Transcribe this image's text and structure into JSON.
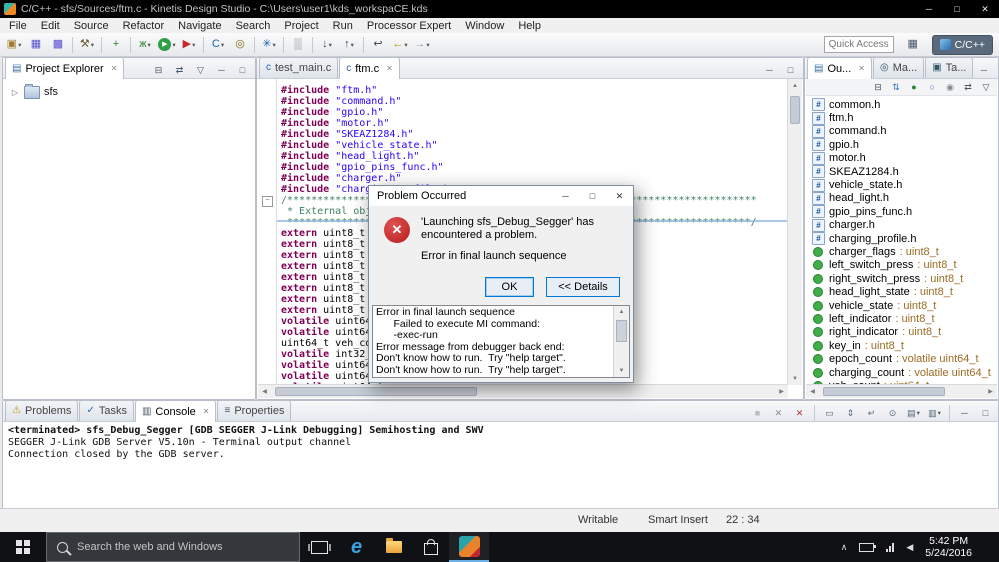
{
  "titlebar": {
    "title": "C/C++ - sfs/Sources/ftm.c - Kinetis Design Studio - C:\\Users\\user1\\kds_workspaCE.kds",
    "minimize": "─",
    "maximize": "□",
    "close": "✕"
  },
  "menubar": [
    "File",
    "Edit",
    "Source",
    "Refactor",
    "Navigate",
    "Search",
    "Project",
    "Run",
    "Processor Expert",
    "Window",
    "Help"
  ],
  "toolbar": {
    "quick_access": "Quick Access",
    "perspective": "C/C++",
    "items": [
      {
        "name": "new-wizard-icon",
        "glyph": "▣",
        "color": "#a07c2c",
        "dd": true
      },
      {
        "name": "save-icon",
        "glyph": "▦",
        "color": "#5a4fcf"
      },
      {
        "name": "save-all-icon",
        "glyph": "▩",
        "color": "#5a4fcf"
      },
      {
        "sep": true
      },
      {
        "name": "build-icon",
        "glyph": "⚒",
        "color": "#6b5b35",
        "dd": true
      },
      {
        "sep": true
      },
      {
        "name": "new-connection-icon",
        "glyph": "+",
        "color": "#2e7d32"
      },
      {
        "sep": true
      },
      {
        "name": "debug-icon",
        "glyph": "ж",
        "color": "#2e7d32",
        "dd": true
      },
      {
        "name": "run-icon",
        "glyph": "▶",
        "color": "#ffffff",
        "bg": "#2f9e44",
        "dd": true
      },
      {
        "name": "external-tools-icon",
        "glyph": "▶",
        "color": "#c62828",
        "dd": true
      },
      {
        "sep": true
      },
      {
        "name": "new-c-file-icon",
        "glyph": "C",
        "color": "#1c5fae",
        "dd": true
      },
      {
        "name": "open-element-icon",
        "glyph": "◎",
        "color": "#7a6a1f"
      },
      {
        "sep": true
      },
      {
        "name": "search-icon",
        "glyph": "✳",
        "color": "#1c5fae",
        "dd": true
      },
      {
        "sep": true
      },
      {
        "name": "mark-occurrences-icon",
        "glyph": "▒",
        "color": "#888888"
      },
      {
        "sep": true
      },
      {
        "name": "next-annotation-icon",
        "glyph": "↓",
        "color": "#444444",
        "dd": true
      },
      {
        "name": "previous-annotation-icon",
        "glyph": "↑",
        "color": "#444444",
        "dd": true
      },
      {
        "sep": true
      },
      {
        "name": "last-edit-location-icon",
        "glyph": "↩",
        "color": "#444444"
      },
      {
        "name": "back-icon",
        "glyph": "←",
        "color": "#b58900",
        "dd": true
      },
      {
        "name": "forward-icon",
        "glyph": "→",
        "color": "#999999",
        "dd": true
      }
    ]
  },
  "project_explorer": {
    "tabs": [
      {
        "id": "tab-project-explorer",
        "label": "Project Explorer",
        "glyph": "▤",
        "color": "#3b6ea5",
        "active": true,
        "closable": true
      }
    ],
    "header_icons": [
      {
        "name": "collapse-all-icon",
        "glyph": "⊟",
        "color": "#445566"
      },
      {
        "name": "link-with-editor-icon",
        "glyph": "⇄",
        "color": "#445566"
      },
      {
        "name": "view-menu-icon",
        "glyph": "▽",
        "color": "#445566"
      },
      {
        "name": "minimize-view-icon",
        "glyph": "─",
        "color": "#445566"
      },
      {
        "name": "maximize-view-icon",
        "glyph": "□",
        "color": "#445566"
      }
    ],
    "items": [
      {
        "label": "sfs",
        "expander": "▷"
      }
    ]
  },
  "editor": {
    "tabs": [
      {
        "id": "tab-test-main-c",
        "label": "test_main.c",
        "glyph": "c",
        "color": "#1c5fae",
        "active": false
      },
      {
        "id": "tab-ftm-c",
        "label": "ftm.c",
        "glyph": "c",
        "color": "#1c5fae",
        "active": true,
        "closable": true
      }
    ],
    "chrome_icons": [
      {
        "name": "minimize-view-icon",
        "glyph": "─",
        "color": "#445566"
      },
      {
        "name": "maximize-view-icon",
        "glyph": "□",
        "color": "#445566"
      }
    ],
    "scroll": {
      "up": "▲",
      "down": "▼",
      "left": "◀",
      "right": "▶"
    },
    "lines": [
      {
        "segs": [
          {
            "t": "#include ",
            "c": "pp"
          },
          {
            "t": "\"ftm.h\"",
            "c": "str"
          }
        ]
      },
      {
        "segs": [
          {
            "t": "#include ",
            "c": "pp"
          },
          {
            "t": "\"command.h\"",
            "c": "str"
          }
        ]
      },
      {
        "segs": [
          {
            "t": "#include ",
            "c": "pp"
          },
          {
            "t": "\"gpio.h\"",
            "c": "str"
          }
        ]
      },
      {
        "segs": [
          {
            "t": "#include ",
            "c": "pp"
          },
          {
            "t": "\"motor.h\"",
            "c": "str"
          }
        ]
      },
      {
        "segs": [
          {
            "t": "#include ",
            "c": "pp"
          },
          {
            "t": "\"SKEAZ1284.h\"",
            "c": "str"
          }
        ]
      },
      {
        "segs": [
          {
            "t": "#include ",
            "c": "pp"
          },
          {
            "t": "\"vehicle_state.h\"",
            "c": "str"
          }
        ]
      },
      {
        "segs": [
          {
            "t": "#include ",
            "c": "pp"
          },
          {
            "t": "\"head_light.h\"",
            "c": "str"
          }
        ]
      },
      {
        "segs": [
          {
            "t": "#include ",
            "c": "pp"
          },
          {
            "t": "\"gpio_pins_func.h\"",
            "c": "str"
          }
        ]
      },
      {
        "segs": [
          {
            "t": "#include ",
            "c": "pp"
          },
          {
            "t": "\"charger.h\"",
            "c": "str"
          }
        ]
      },
      {
        "segs": [
          {
            "t": "#include ",
            "c": "pp"
          },
          {
            "t": "\"charging_profile.h\"",
            "c": "str"
          }
        ]
      },
      {
        "segs": [
          {
            "t": "/******************************************************************************",
            "c": "cmt"
          }
        ]
      },
      {
        "segs": [
          {
            "t": " * External objec",
            "c": "cmt"
          }
        ]
      },
      {
        "segs": [
          {
            "t": " *****************************************************************************/",
            "c": "cmt"
          }
        ]
      },
      {
        "segs": [
          {
            "t": "extern",
            "c": "kw"
          },
          {
            "t": " uint8_t ch",
            "c": "pl"
          }
        ]
      },
      {
        "segs": [
          {
            "t": "extern",
            "c": "kw"
          },
          {
            "t": " uint8_t le",
            "c": "pl"
          }
        ]
      },
      {
        "segs": [
          {
            "t": "extern",
            "c": "kw"
          },
          {
            "t": " uint8_t ri",
            "c": "pl"
          }
        ]
      },
      {
        "segs": [
          {
            "t": "extern",
            "c": "kw"
          },
          {
            "t": " uint8_t he",
            "c": "pl"
          }
        ]
      },
      {
        "segs": [
          {
            "t": "extern",
            "c": "kw"
          },
          {
            "t": " uint8_t ve",
            "c": "pl"
          }
        ]
      },
      {
        "segs": [
          {
            "t": "extern",
            "c": "kw"
          },
          {
            "t": " uint8_t le",
            "c": "pl"
          }
        ]
      },
      {
        "segs": [
          {
            "t": "extern",
            "c": "kw"
          },
          {
            "t": " uint8_t ri",
            "c": "pl"
          }
        ]
      },
      {
        "segs": [
          {
            "t": "extern",
            "c": "kw"
          },
          {
            "t": " uint8_t ke",
            "c": "pl"
          }
        ]
      },
      {
        "segs": [
          {
            "t": "volatile",
            "c": "kw"
          },
          {
            "t": " uint64_t",
            "c": "pl"
          }
        ]
      },
      {
        "segs": [
          {
            "t": "volatile",
            "c": "kw"
          },
          {
            "t": " uint64_t",
            "c": "pl"
          }
        ]
      },
      {
        "segs": [
          {
            "t": "uint64_t veh_coun",
            "c": "pl"
          }
        ]
      },
      {
        "segs": [
          {
            "t": "volatile",
            "c": "kw"
          },
          {
            "t": " int32_t ",
            "c": "pl"
          }
        ]
      },
      {
        "segs": [
          {
            "t": "volatile",
            "c": "kw"
          },
          {
            "t": " uint64_t",
            "c": "pl"
          }
        ]
      },
      {
        "segs": [
          {
            "t": "volatile",
            "c": "kw"
          },
          {
            "t": " uint64_t",
            "c": "pl"
          }
        ]
      },
      {
        "segs": [
          {
            "t": "volatile",
            "c": "kw"
          },
          {
            "t": " uint64_t",
            "c": "pl"
          }
        ]
      }
    ]
  },
  "outline": {
    "tabs": [
      {
        "id": "tab-outline",
        "label": "Ou...",
        "glyph": "▤",
        "color": "#3b6ea5",
        "active": true,
        "closable": true
      },
      {
        "id": "tab-make-targets",
        "label": "Ma...",
        "glyph": "◎",
        "color": "#335566",
        "active": false
      },
      {
        "id": "tab-task-list",
        "label": "Ta...",
        "glyph": "▣",
        "color": "#335566",
        "active": false
      }
    ],
    "chrome_icons": [
      {
        "name": "minimize-view-icon",
        "glyph": "─",
        "color": "#445566"
      },
      {
        "name": "maximize-view-icon",
        "glyph": "□",
        "color": "#445566"
      }
    ],
    "toolbar_icons": [
      {
        "name": "collapse-all-icon",
        "glyph": "⊟",
        "color": "#445566"
      },
      {
        "name": "sort-icon",
        "glyph": "⇅",
        "color": "#2b6cb0"
      },
      {
        "name": "hide-fields-icon",
        "glyph": "●",
        "color": "#2e7d32"
      },
      {
        "name": "hide-static-icon",
        "glyph": "○",
        "color": "#2b6cb0"
      },
      {
        "name": "hide-non-public-icon",
        "glyph": "◉",
        "color": "#888888"
      },
      {
        "name": "link-with-editor-icon",
        "glyph": "⇄",
        "color": "#445566"
      },
      {
        "name": "view-menu-icon",
        "glyph": "▽",
        "color": "#445566"
      }
    ],
    "items": [
      {
        "kind": "include",
        "label": "common.h"
      },
      {
        "kind": "include",
        "label": "ftm.h"
      },
      {
        "kind": "include",
        "label": "command.h"
      },
      {
        "kind": "include",
        "label": "gpio.h"
      },
      {
        "kind": "include",
        "label": "motor.h"
      },
      {
        "kind": "include",
        "label": "SKEAZ1284.h"
      },
      {
        "kind": "include",
        "label": "vehicle_state.h"
      },
      {
        "kind": "include",
        "label": "head_light.h"
      },
      {
        "kind": "include",
        "label": "gpio_pins_func.h"
      },
      {
        "kind": "include",
        "label": "charger.h"
      },
      {
        "kind": "include",
        "label": "charging_profile.h"
      },
      {
        "kind": "var",
        "label": "charger_flags",
        "type": "uint8_t"
      },
      {
        "kind": "var",
        "label": "left_switch_press",
        "type": "uint8_t"
      },
      {
        "kind": "var",
        "label": "right_switch_press",
        "type": "uint8_t"
      },
      {
        "kind": "var",
        "label": "head_light_state",
        "type": "uint8_t"
      },
      {
        "kind": "var",
        "label": "vehicle_state",
        "type": "uint8_t"
      },
      {
        "kind": "var",
        "label": "left_indicator",
        "type": "uint8_t"
      },
      {
        "kind": "var",
        "label": "right_indicator",
        "type": "uint8_t"
      },
      {
        "kind": "var",
        "label": "key_in",
        "type": "uint8_t"
      },
      {
        "kind": "var",
        "label": "epoch_count",
        "type": "volatile uint64_t"
      },
      {
        "kind": "var",
        "label": "charging_count",
        "type": "volatile uint64_t"
      },
      {
        "kind": "var",
        "label": "veh_count",
        "type": "uint64_t"
      }
    ]
  },
  "console": {
    "tabs": [
      {
        "id": "tab-problems",
        "label": "Problems",
        "glyph": "⚠",
        "color": "#b7950b",
        "active": false
      },
      {
        "id": "tab-tasks",
        "label": "Tasks",
        "glyph": "✓",
        "color": "#2b6cb0",
        "active": false
      },
      {
        "id": "tab-console",
        "label": "Console",
        "glyph": "▥",
        "color": "#445566",
        "active": true,
        "closable": true
      },
      {
        "id": "tab-properties",
        "label": "Properties",
        "glyph": "≡",
        "color": "#445566",
        "active": false
      }
    ],
    "toolbar_icons": [
      {
        "name": "terminate-icon",
        "glyph": "■",
        "color": "#bbbbbb"
      },
      {
        "name": "remove-launch-icon",
        "glyph": "✕",
        "color": "#888888"
      },
      {
        "name": "remove-all-launches-icon",
        "glyph": "✕",
        "color": "#aa3333"
      },
      {
        "sep": true
      },
      {
        "name": "clear-console-icon",
        "glyph": "▭",
        "color": "#556677"
      },
      {
        "name": "scroll-lock-icon",
        "glyph": "⇕",
        "color": "#556677"
      },
      {
        "name": "word-wrap-icon",
        "glyph": "↵",
        "color": "#556677"
      },
      {
        "name": "pin-console-icon",
        "glyph": "⊙",
        "color": "#556677"
      },
      {
        "name": "display-selected-console-icon",
        "glyph": "▤",
        "color": "#556677",
        "dd": true
      },
      {
        "name": "open-console-icon",
        "glyph": "▥",
        "color": "#556677",
        "dd": true
      },
      {
        "sep": true
      },
      {
        "name": "minimize-view-icon",
        "glyph": "─",
        "color": "#445566"
      },
      {
        "name": "maximize-view-icon",
        "glyph": "□",
        "color": "#445566"
      }
    ],
    "lines": [
      {
        "text": "<terminated> sfs_Debug_Segger [GDB SEGGER J-Link Debugging] Semihosting and SWV",
        "strong": true
      },
      {
        "text": "SEGGER J-Link GDB Server V5.10n - Terminal output channel"
      },
      {
        "text": "Connection closed by the GDB server."
      }
    ]
  },
  "status": {
    "writable": "Writable",
    "insert_mode": "Smart Insert",
    "position": "22 : 34"
  },
  "dialog": {
    "title": "Problem Occurred",
    "minimize": "─",
    "maximize": "□",
    "close": "✕",
    "message1": "'Launching sfs_Debug_Segger' has encountered a problem.",
    "message2": "Error in final launch sequence",
    "ok": "OK",
    "details_toggle": "<< Details",
    "details": [
      "Error in final launch sequence",
      "      Failed to execute MI command:",
      "      -exec-run",
      "Error message from debugger back end:",
      "Don't know how to run.  Try \"help target\".",
      "Don't know how to run.  Try \"help target\"."
    ]
  },
  "taskbar": {
    "search_placeholder": "Search the web and Windows",
    "time": "5:42 PM",
    "date": "5/24/2016"
  }
}
